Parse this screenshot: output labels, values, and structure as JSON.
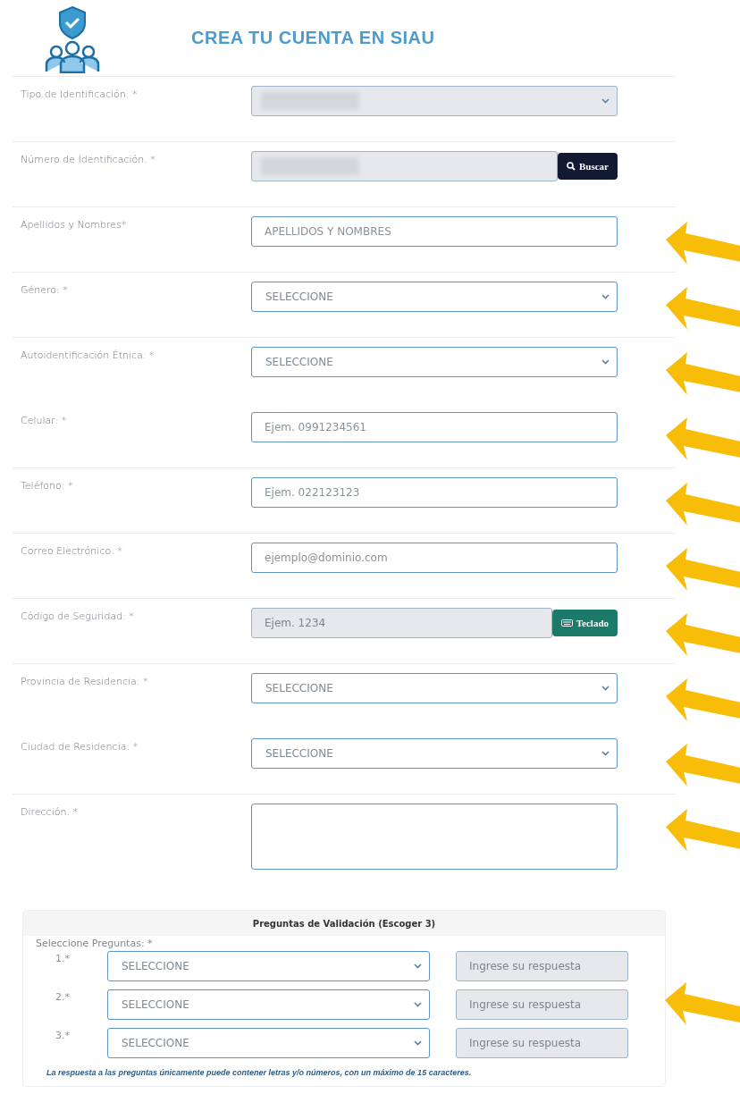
{
  "header": {
    "title": "CREA TU CUENTA EN SIAU"
  },
  "fields": [
    {
      "label": "Tipo de Identificación: *",
      "kind": "select",
      "redacted": true,
      "disabled": true,
      "divider": true,
      "marked": false
    },
    {
      "label": "Número de Identificación. *",
      "kind": "input",
      "redacted": true,
      "disabled": true,
      "divider": true,
      "marked": false,
      "button": {
        "label": "Buscar",
        "kind": "search"
      }
    },
    {
      "label": "Apellidos y Nombres*",
      "kind": "input",
      "placeholder": "APELLIDOS Y NOMBRES",
      "disabled": false,
      "divider": true,
      "marked": true
    },
    {
      "label": "Género: *",
      "kind": "select",
      "value": "SELECCIONE",
      "disabled": false,
      "divider": true,
      "marked": true
    },
    {
      "label": "Autoidentificación Étnica: *",
      "kind": "select",
      "value": "SELECCIONE",
      "disabled": false,
      "divider": true,
      "marked": true
    },
    {
      "label": "Celular: *",
      "kind": "input",
      "placeholder": "Ejem. 0991234561",
      "disabled": false,
      "divider": false,
      "marked": true
    },
    {
      "label": "Teléfono: *",
      "kind": "input",
      "placeholder": "Ejem. 022123123",
      "disabled": false,
      "divider": true,
      "marked": true
    },
    {
      "label": "Correo Electrónico: *",
      "kind": "input",
      "placeholder": "ejemplo@dominio.com",
      "disabled": false,
      "divider": true,
      "marked": true
    },
    {
      "label": "Código de Seguridad: *",
      "kind": "input",
      "placeholder": "Ejem. 1234",
      "disabled": true,
      "divider": true,
      "marked": true,
      "button": {
        "label": "Teclado",
        "kind": "keyboard"
      }
    },
    {
      "label": "Provincia de Residencia: *",
      "kind": "select",
      "value": "SELECCIONE",
      "disabled": false,
      "divider": true,
      "marked": true
    },
    {
      "label": "Ciudad de Residencia: *",
      "kind": "select",
      "value": "SELECCIONE",
      "disabled": false,
      "divider": false,
      "marked": true
    },
    {
      "label": "Dirección. *",
      "kind": "textarea",
      "disabled": false,
      "divider": true,
      "marked": true
    }
  ],
  "questions": {
    "title": "Preguntas de Validación (Escoger 3)",
    "label": "Seleccione Preguntas: *",
    "rows": [
      {
        "number": "1.*",
        "value": "SELECCIONE",
        "placeholder": "Ingrese su respuesta",
        "disabled": true,
        "marked": false
      },
      {
        "number": "2.*",
        "value": "SELECCIONE",
        "placeholder": "Ingrese su respuesta",
        "disabled": true,
        "marked": true
      },
      {
        "number": "3.*",
        "value": "SELECCIONE",
        "placeholder": "Ingrese su respuesta",
        "disabled": true,
        "marked": false
      }
    ],
    "note": "La respuesta a las preguntas únicamente puede contener letras y/o números, con un máximo de 15 caracteres."
  }
}
